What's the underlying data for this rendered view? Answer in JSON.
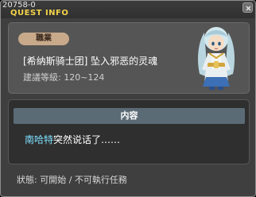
{
  "window": {
    "quest_id": "20758-0",
    "title": "QUEST INFO"
  },
  "quest": {
    "job_label": "職業",
    "name": "[希纳斯骑士团] 坠入邪恶的灵魂",
    "level_recommendation": "建議等級: 120~124"
  },
  "content": {
    "header": "内容",
    "npc_name": "南哈特",
    "dialog_text": "突然说话了……"
  },
  "footer": {
    "status": "狀態: 可開始 / 不可執行任務"
  },
  "colors": {
    "title": "#f2d34a",
    "npc_name": "#7fe0ff",
    "job_badge": "#c8a98a"
  }
}
